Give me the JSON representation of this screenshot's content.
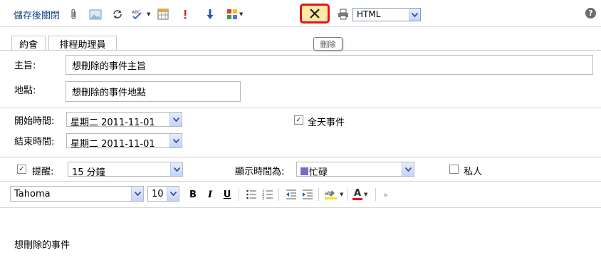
{
  "toolbar": {
    "save_close_label": "儲存後關閉",
    "format": "HTML",
    "delete_tooltip": "刪除",
    "help_label": "?"
  },
  "tabs": [
    {
      "label": "約會",
      "active": true
    },
    {
      "label": "排程助理員",
      "active": false
    }
  ],
  "form": {
    "subject_label": "主旨:",
    "subject_value": "想刪除的事件主旨",
    "location_label": "地點:",
    "location_value": "想刪除的事件地點",
    "start_label": "開始時間:",
    "start_value": "星期二 2011-11-01",
    "end_label": "結束時間:",
    "end_value": "星期二 2011-11-01",
    "all_day_label": "全天事件",
    "all_day_checked": true,
    "reminder_label": "提醒:",
    "reminder_checked": true,
    "reminder_value": "15 分鐘",
    "show_as_label": "顯示時間為:",
    "show_as_value": "忙碌",
    "show_as_color": "#7b68c8",
    "private_label": "私人",
    "private_checked": false
  },
  "format_bar": {
    "font": "Tahoma",
    "size": "10",
    "bold": "B",
    "italic": "I",
    "underline": "U",
    "font_color_glyph": "A",
    "highlight_glyph": "ab",
    "more": "»"
  },
  "body_text": "想刪除的事件",
  "colors": {
    "accent_blue": "#15428b",
    "delete_highlight_border": "#e8121b",
    "delete_highlight_fill": "#fde8a6"
  }
}
